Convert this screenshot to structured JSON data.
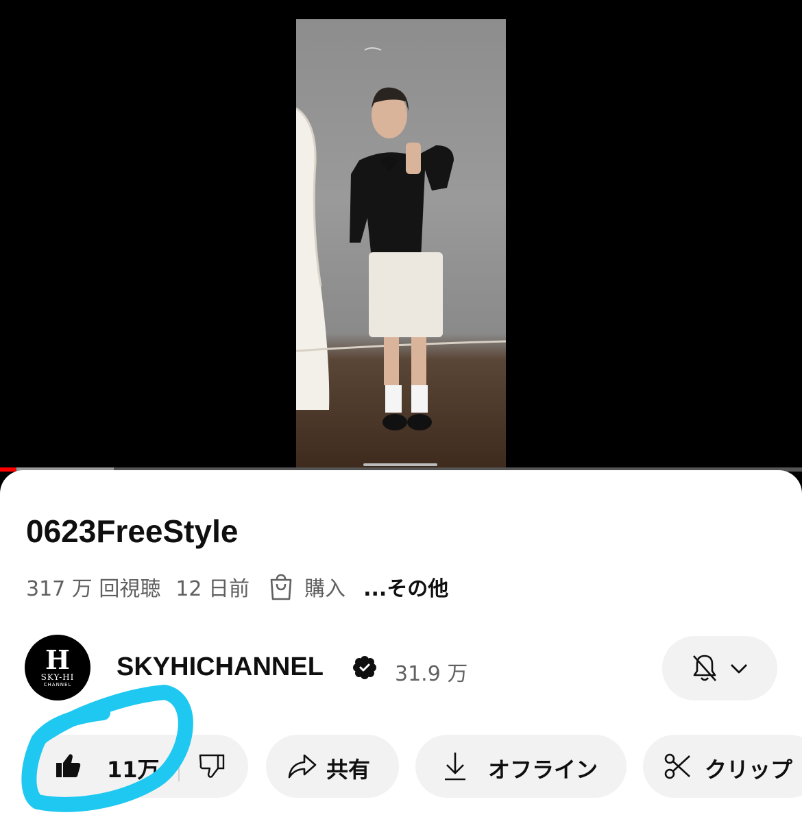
{
  "video": {
    "title": "0623FreeStyle",
    "views": "317 万 回視聴",
    "posted": "12 日前",
    "purchase_label": "購入",
    "more_label": "...その他",
    "progress_fraction": 0.02
  },
  "channel": {
    "name": "SKYHICHANNEL",
    "subscribers": "31.9 万",
    "avatar_letter": "H",
    "avatar_line": "SKY-HI",
    "avatar_sub": "CHANNEL"
  },
  "actions": {
    "like_count": "11万",
    "share_label": "共有",
    "offline_label": "オフライン",
    "clip_label": "クリップ"
  },
  "colors": {
    "accent": "#ff0000",
    "highlight": "#1ec8f0",
    "pill_bg": "#f2f2f2"
  },
  "icons": [
    "like-icon",
    "dislike-icon",
    "share-icon",
    "download-icon",
    "scissors-icon",
    "bell-off-icon",
    "chevron-down-icon",
    "shopping-bag-icon",
    "verified-icon"
  ]
}
